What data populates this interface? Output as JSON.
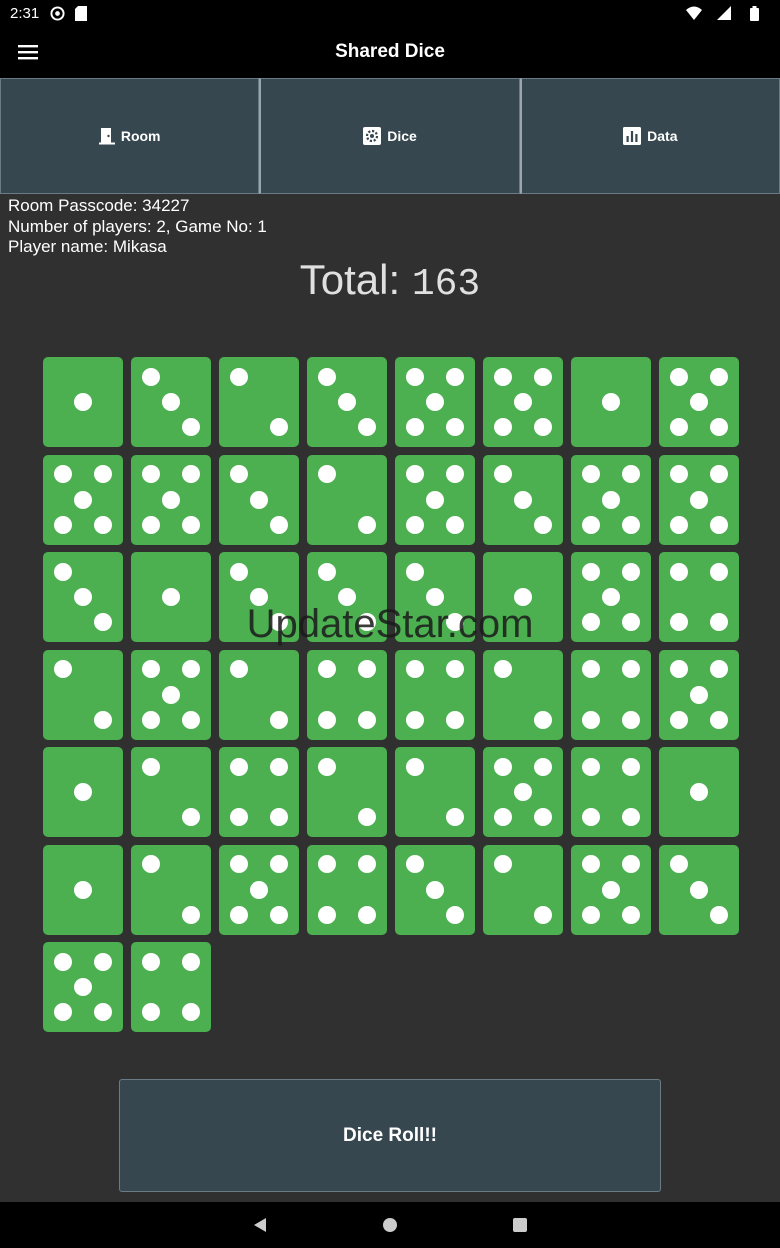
{
  "status_bar": {
    "time": "2:31"
  },
  "app_bar": {
    "title": "Shared Dice"
  },
  "tabs": [
    {
      "label": "Room",
      "icon": "door-icon"
    },
    {
      "label": "Dice",
      "icon": "gear-icon"
    },
    {
      "label": "Data",
      "icon": "bar-chart-icon"
    }
  ],
  "info": {
    "passcode_line": "Room Passcode: 34227",
    "players_line": "Number of players: 2,  Game No: 1",
    "player_line": "Player name: Mikasa"
  },
  "total": {
    "label": "Total: ",
    "value": "163"
  },
  "dice": [
    1,
    3,
    2,
    3,
    5,
    5,
    1,
    5,
    5,
    5,
    3,
    2,
    5,
    3,
    5,
    5,
    3,
    1,
    3,
    3,
    3,
    1,
    5,
    4,
    2,
    5,
    2,
    4,
    4,
    2,
    4,
    5,
    1,
    2,
    4,
    2,
    2,
    5,
    4,
    1,
    1,
    2,
    5,
    4,
    3,
    2,
    5,
    3,
    5,
    4
  ],
  "watermark": "UpdateStar.com",
  "roll_button": {
    "label": "Dice Roll!!"
  },
  "colors": {
    "die": "#4CAF50",
    "tab": "#37474F",
    "background": "#303030"
  }
}
